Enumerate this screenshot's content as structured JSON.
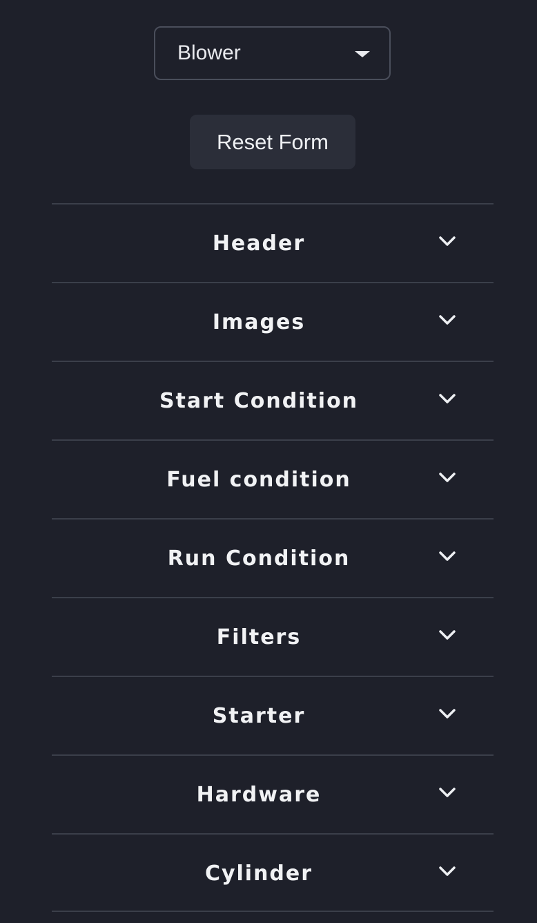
{
  "dropdown": {
    "selected": "Blower"
  },
  "reset_button": {
    "label": "Reset Form"
  },
  "accordion": {
    "sections": [
      {
        "label": "Header"
      },
      {
        "label": "Images"
      },
      {
        "label": "Start Condition"
      },
      {
        "label": "Fuel condition"
      },
      {
        "label": "Run Condition"
      },
      {
        "label": "Filters"
      },
      {
        "label": "Starter"
      },
      {
        "label": "Hardware"
      },
      {
        "label": "Cylinder"
      }
    ],
    "chevron_icon": "chevron-down-icon"
  },
  "colors": {
    "background": "#1e202a",
    "button_bg": "#2b2e39",
    "divider": "#3b3f4a",
    "text": "#f1f2f4"
  }
}
